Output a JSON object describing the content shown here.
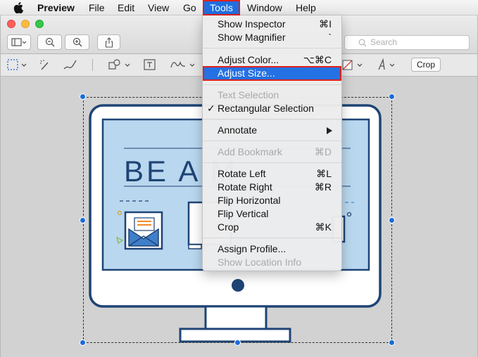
{
  "menubar": {
    "app_name": "Preview",
    "items": [
      "File",
      "Edit",
      "View",
      "Go",
      "Tools",
      "Window",
      "Help"
    ]
  },
  "toolbar": {
    "search_placeholder": "Search",
    "crop_label": "Crop"
  },
  "tools_menu": {
    "items": [
      {
        "label": "Show Inspector",
        "shortcut": "⌘I",
        "enabled": true
      },
      {
        "label": "Show Magnifier",
        "shortcut": "`",
        "enabled": true
      },
      {
        "label": "Adjust Color...",
        "shortcut": "⌥⌘C",
        "enabled": true
      },
      {
        "label": "Adjust Size...",
        "shortcut": "",
        "enabled": true,
        "highlighted": true
      },
      {
        "label": "Text Selection",
        "shortcut": "",
        "enabled": false
      },
      {
        "label": "Rectangular Selection",
        "shortcut": "",
        "enabled": true,
        "checked": true
      },
      {
        "label": "Annotate",
        "shortcut": "",
        "enabled": true,
        "submenu": true
      },
      {
        "label": "Add Bookmark",
        "shortcut": "⌘D",
        "enabled": false
      },
      {
        "label": "Rotate Left",
        "shortcut": "⌘L",
        "enabled": true
      },
      {
        "label": "Rotate Right",
        "shortcut": "⌘R",
        "enabled": true
      },
      {
        "label": "Flip Horizontal",
        "shortcut": "",
        "enabled": true
      },
      {
        "label": "Flip Vertical",
        "shortcut": "",
        "enabled": true
      },
      {
        "label": "Crop",
        "shortcut": "⌘K",
        "enabled": true
      },
      {
        "label": "Assign Profile...",
        "shortcut": "",
        "enabled": true
      },
      {
        "label": "Show Location Info",
        "shortcut": "",
        "enabled": false
      }
    ]
  },
  "document": {
    "headline_text": "BE A M"
  },
  "colors": {
    "accent": "#2471e3",
    "highlight_outline": "#e0211c",
    "illustration_blue": "#1e4475",
    "illustration_bg": "#b9d7ee"
  }
}
